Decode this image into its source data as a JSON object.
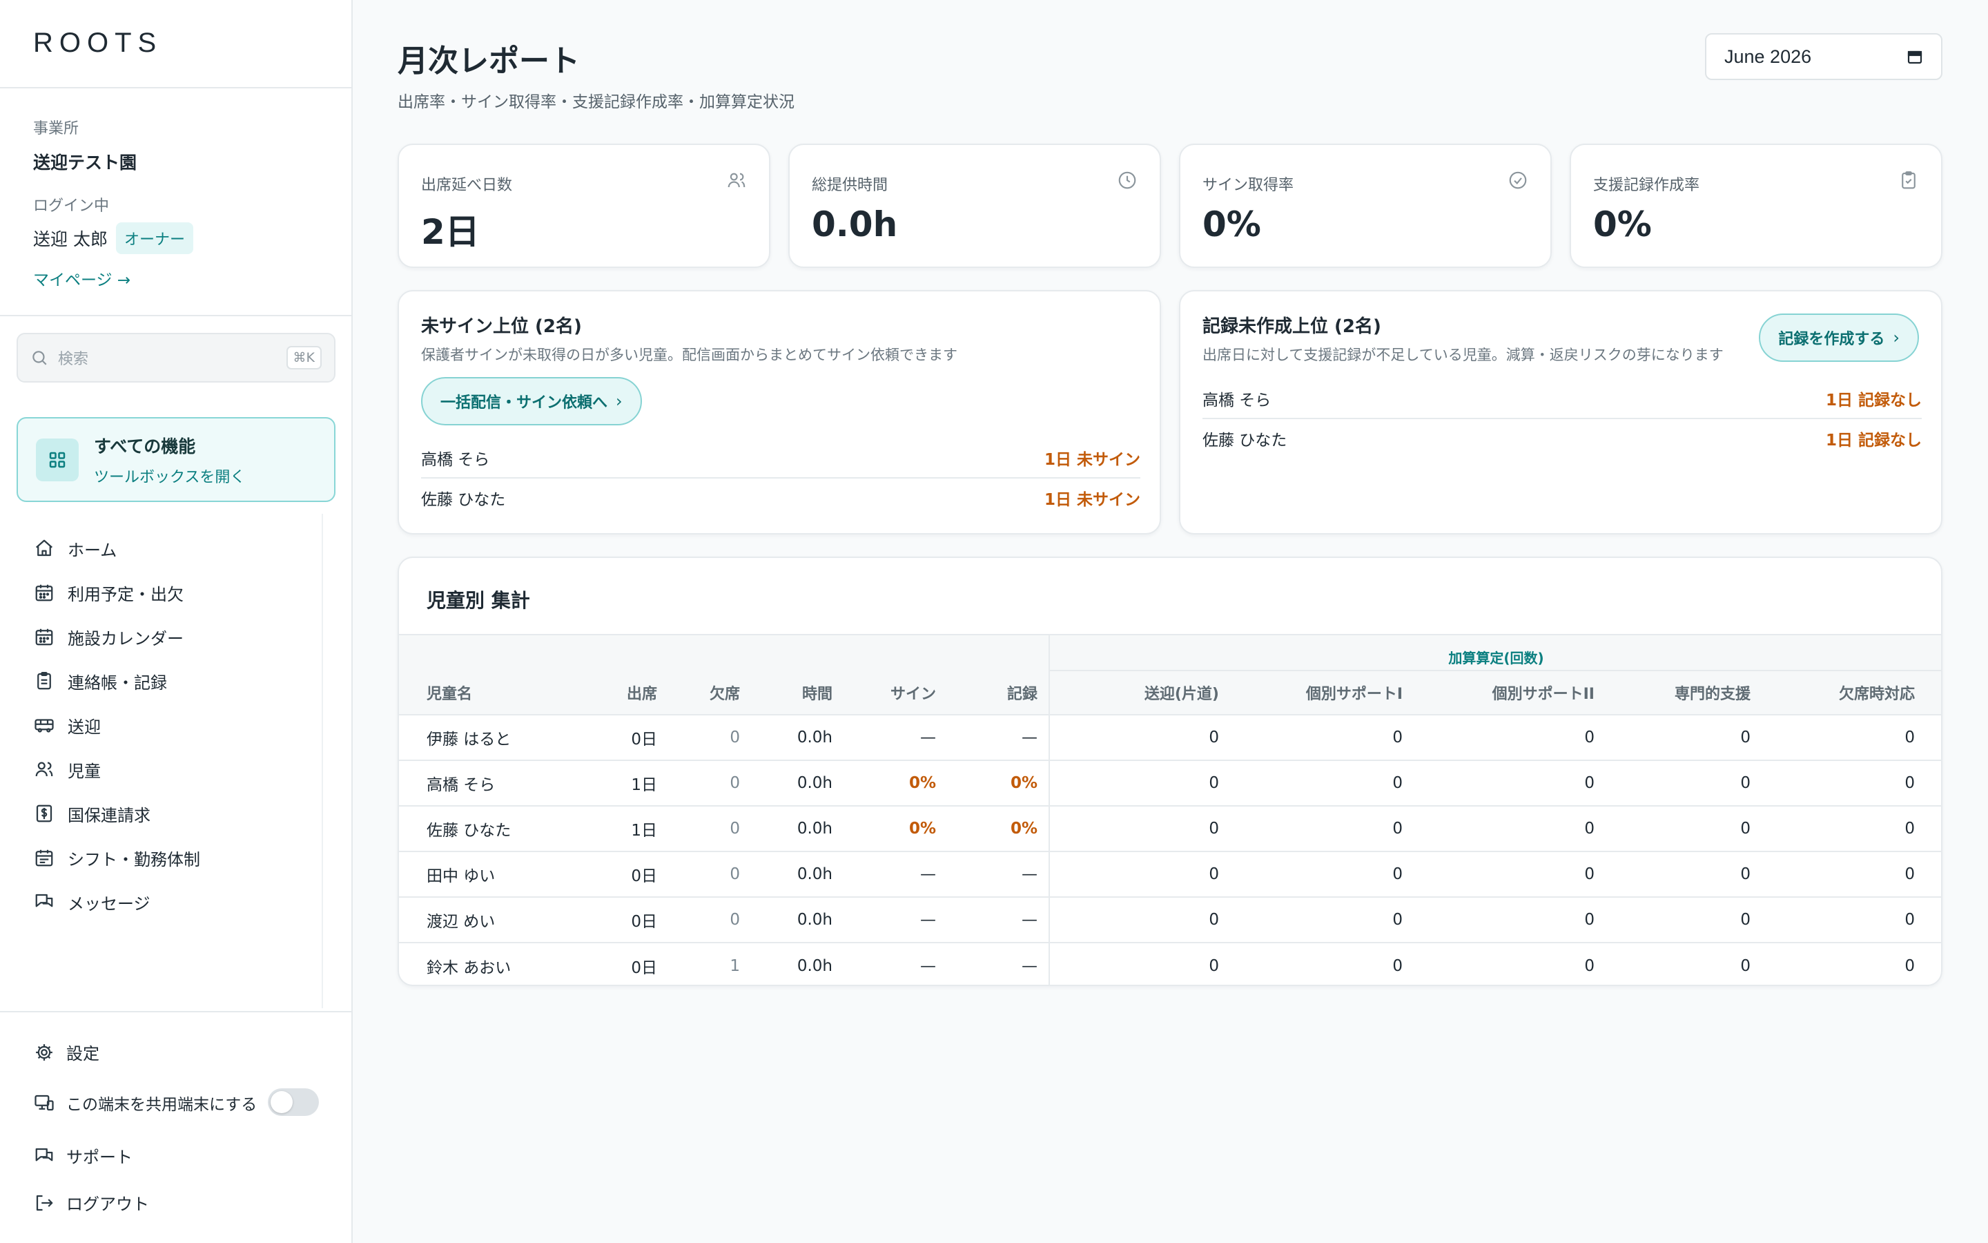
{
  "brand": "ROOTS",
  "sidebar": {
    "facility_label": "事業所",
    "facility_name": "送迎テスト園",
    "login_label": "ログイン中",
    "user_name": "送迎 太郎",
    "role_badge": "オーナー",
    "mypage_link": "マイページ →",
    "search_placeholder": "検索",
    "search_shortcut": "⌘K",
    "toolbox_title": "すべての機能",
    "toolbox_sub": "ツールボックスを開く",
    "nav": [
      {
        "label": "ホーム",
        "icon": "home-icon"
      },
      {
        "label": "利用予定・出欠",
        "icon": "calendar-icon"
      },
      {
        "label": "施設カレンダー",
        "icon": "calendar-icon"
      },
      {
        "label": "連絡帳・記録",
        "icon": "clipboard-icon"
      },
      {
        "label": "送迎",
        "icon": "bus-icon"
      },
      {
        "label": "児童",
        "icon": "users-icon"
      },
      {
        "label": "国保連請求",
        "icon": "dollar-icon"
      },
      {
        "label": "シフト・勤務体制",
        "icon": "calendar-icon"
      },
      {
        "label": "メッセージ",
        "icon": "chat-icon"
      }
    ],
    "settings": "設定",
    "shared_terminal": "この端末を共用端末にする",
    "shared_terminal_on": false,
    "support": "サポート",
    "logout": "ログアウト"
  },
  "header": {
    "title": "月次レポート",
    "subtitle": "出席率・サイン取得率・支援記録作成率・加算算定状況",
    "month": "June 2026"
  },
  "kpis": [
    {
      "label": "出席延べ日数",
      "value": "2日",
      "icon": "users-icon"
    },
    {
      "label": "総提供時間",
      "value": "0.0h",
      "icon": "clock-icon"
    },
    {
      "label": "サイン取得率",
      "value": "0%",
      "icon": "check-circle-icon"
    },
    {
      "label": "支援記録作成率",
      "value": "0%",
      "icon": "clipboard-check-icon"
    }
  ],
  "unsigned_panel": {
    "title": "未サイン上位 (2名)",
    "desc": "保護者サインが未取得の日が多い児童。配信画面からまとめてサイン依頼できます",
    "button": "一括配信・サイン依頼へ",
    "rows": [
      {
        "name": "高橋 そら",
        "status": "1日 未サイン"
      },
      {
        "name": "佐藤 ひなた",
        "status": "1日 未サイン"
      }
    ]
  },
  "unrecorded_panel": {
    "title": "記録未作成上位 (2名)",
    "desc": "出席日に対して支援記録が不足している児童。減算・返戻リスクの芽になります",
    "button": "記録を作成する",
    "rows": [
      {
        "name": "高橋 そら",
        "status": "1日 記録なし"
      },
      {
        "name": "佐藤 ひなた",
        "status": "1日 記録なし"
      }
    ]
  },
  "summary": {
    "title": "児童別 集計",
    "group_header": "加算算定(回数)",
    "columns": [
      "児童名",
      "出席",
      "欠席",
      "時間",
      "サイン",
      "記録",
      "送迎(片道)",
      "個別サポートI",
      "個別サポートII",
      "専門的支援",
      "欠席時対応"
    ],
    "rows": [
      [
        "伊藤 はると",
        "0日",
        "0",
        "0.0h",
        "—",
        "—",
        "0",
        "0",
        "0",
        "0",
        "0"
      ],
      [
        "高橋 そら",
        "1日",
        "0",
        "0.0h",
        "0%",
        "0%",
        "0",
        "0",
        "0",
        "0",
        "0"
      ],
      [
        "佐藤 ひなた",
        "1日",
        "0",
        "0.0h",
        "0%",
        "0%",
        "0",
        "0",
        "0",
        "0",
        "0"
      ],
      [
        "田中 ゆい",
        "0日",
        "0",
        "0.0h",
        "—",
        "—",
        "0",
        "0",
        "0",
        "0",
        "0"
      ],
      [
        "渡辺 めい",
        "0日",
        "0",
        "0.0h",
        "—",
        "—",
        "0",
        "0",
        "0",
        "0",
        "0"
      ],
      [
        "鈴木 あおい",
        "0日",
        "1",
        "0.0h",
        "—",
        "—",
        "0",
        "0",
        "0",
        "0",
        "0"
      ]
    ]
  },
  "colors": {
    "accent": "#0b7f80",
    "warning": "#c25b0a",
    "text": "#1f2a33",
    "muted": "#6b7780"
  }
}
